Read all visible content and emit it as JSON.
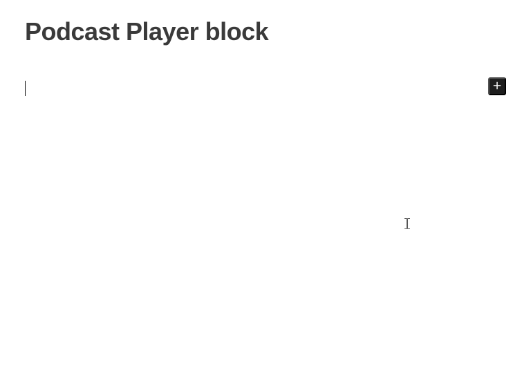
{
  "editor": {
    "title": "Podcast Player block",
    "paragraph_text": "",
    "paragraph_placeholder": ""
  },
  "inserter": {
    "label": "Add block",
    "icon": "plus-icon"
  }
}
